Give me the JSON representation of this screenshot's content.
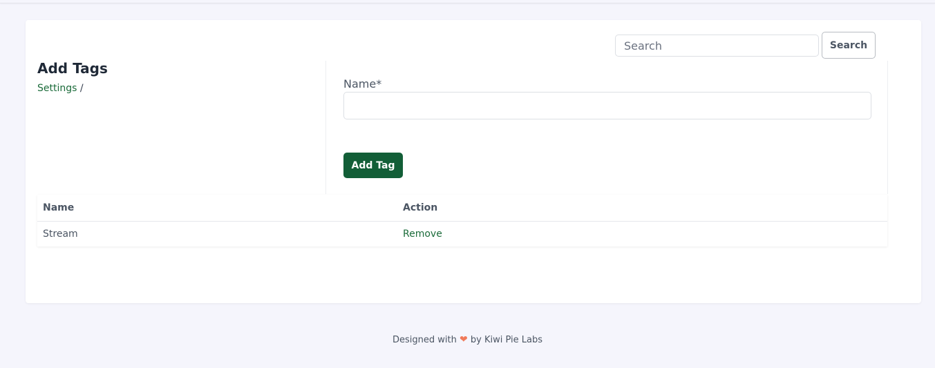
{
  "header": {
    "search_placeholder": "Search",
    "search_button_label": "Search"
  },
  "page": {
    "title": "Add Tags",
    "breadcrumb": {
      "link": "Settings",
      "separator": " /"
    }
  },
  "form": {
    "name_label": "Name*",
    "name_value": "",
    "submit_label": "Add Tag"
  },
  "table": {
    "columns": [
      "Name",
      "Action"
    ],
    "rows": [
      {
        "name": "Stream",
        "action": "Remove"
      }
    ]
  },
  "footer": {
    "prefix": "Designed with",
    "icon": "heart-icon",
    "suffix": "by Kiwi Pie Labs"
  },
  "colors": {
    "background": "#f5f5fc",
    "primary_button": "#125e37",
    "link": "#1b6b3a",
    "heart": "#f07a5a"
  }
}
